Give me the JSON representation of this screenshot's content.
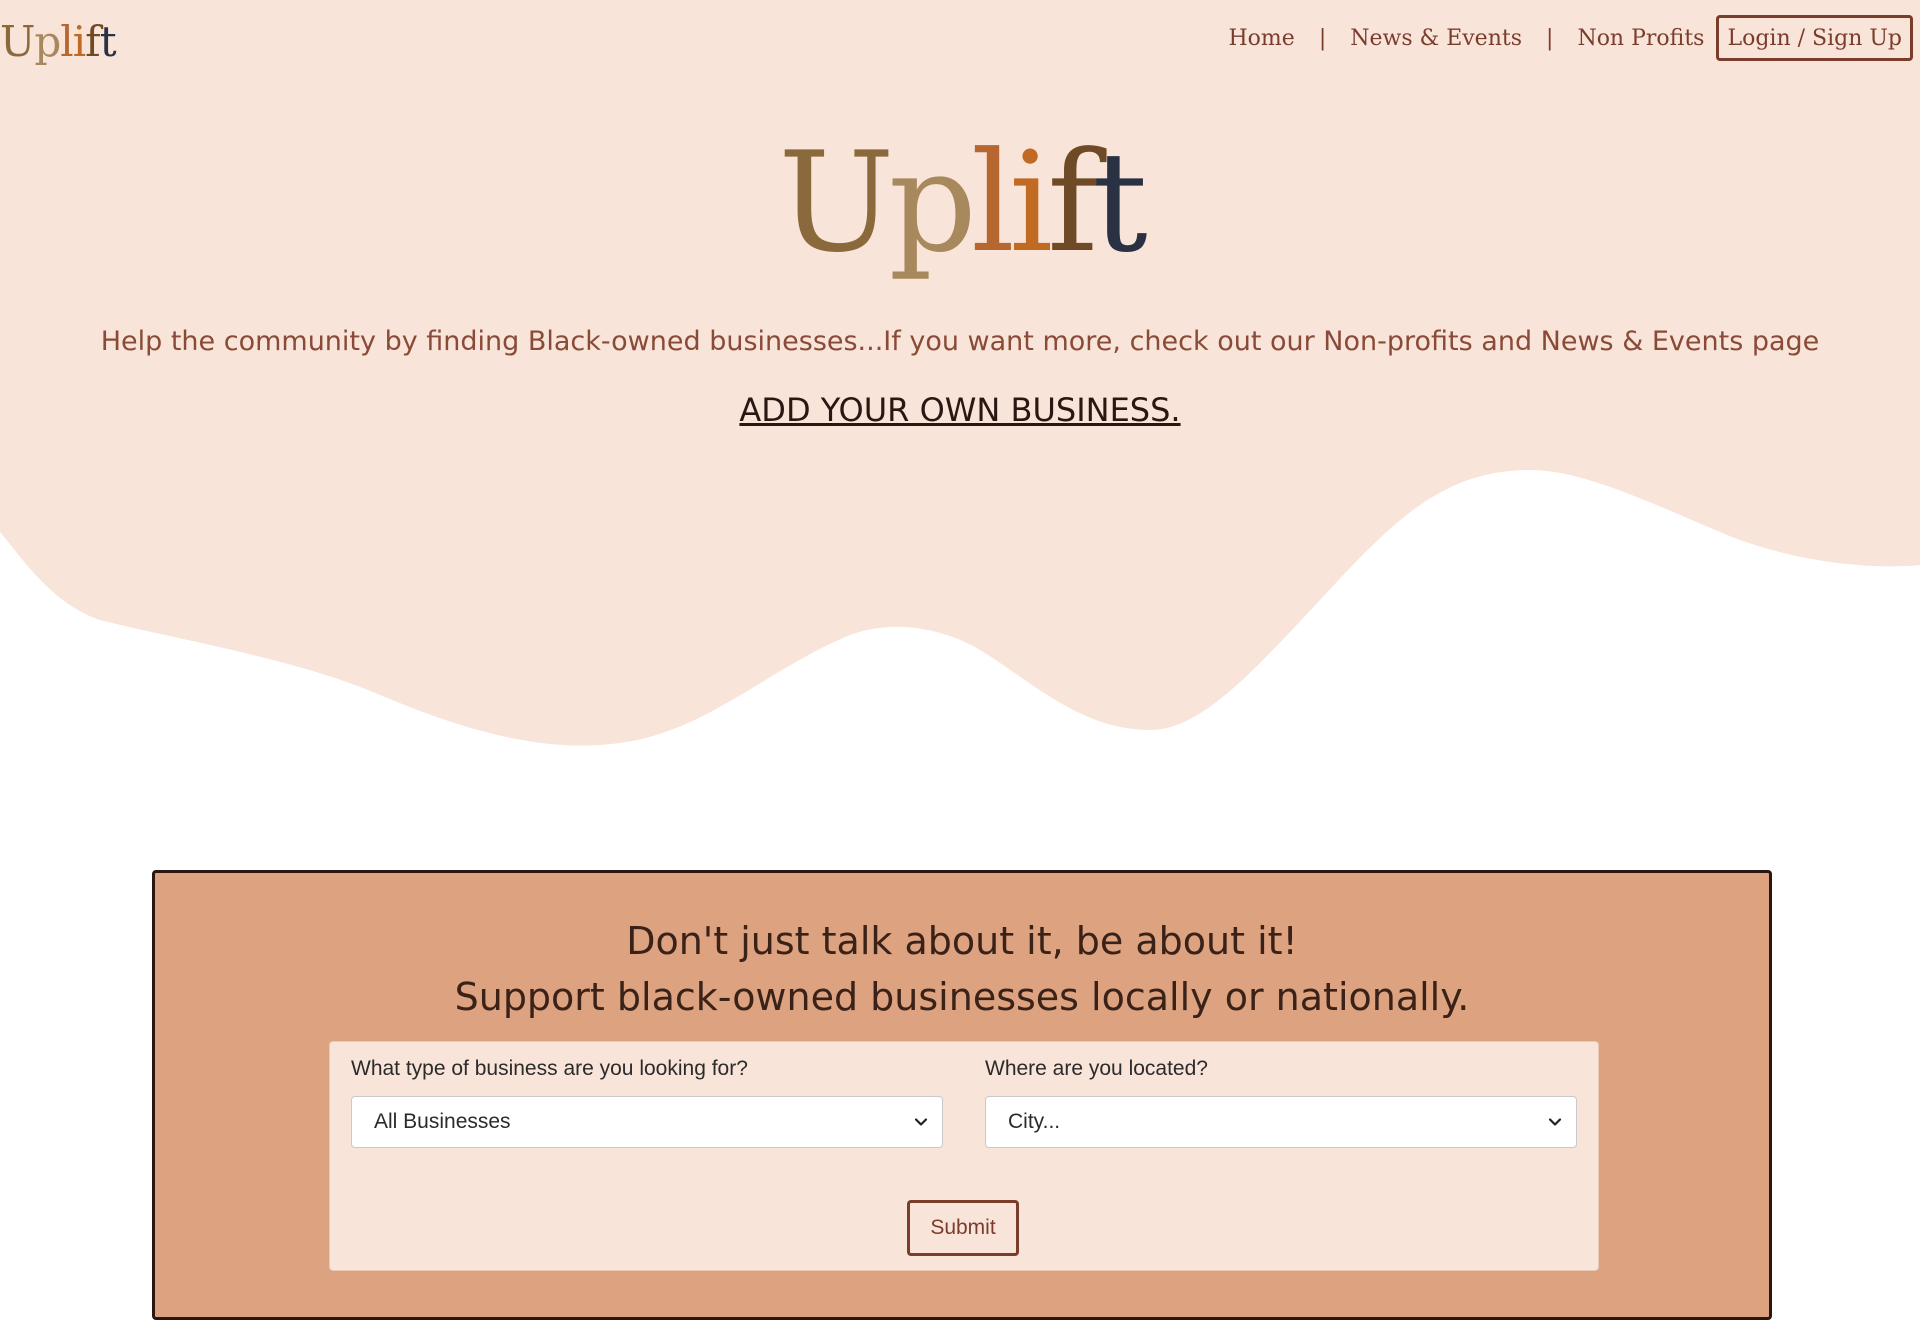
{
  "header": {
    "brand_letters": [
      "U",
      "p",
      "l",
      "i",
      "f",
      "t"
    ],
    "nav": {
      "home": "Home",
      "separator": "|",
      "news_events": "News & Events",
      "non_profits": "Non Profits",
      "login": "Login / Sign Up"
    }
  },
  "hero": {
    "title_letters": [
      "U",
      "p",
      "l",
      "i",
      "f",
      "t"
    ],
    "subtitle": "Help the community by finding Black-owned businesses...If you want more, check out our Non-profits and News & Events page",
    "add_business_link": "ADD YOUR OWN BUSINESS."
  },
  "search": {
    "headline_line1": "Don't just talk about it, be about it!",
    "headline_line2": "Support black-owned businesses locally or nationally.",
    "business_type": {
      "label": "What type of business are you looking for?",
      "selected": "All Businesses"
    },
    "location": {
      "label": "Where are you located?",
      "selected": "City..."
    },
    "submit_label": "Submit"
  },
  "icons": {
    "select_chevron": "chevron-down-icon",
    "hero_wave": "wave-shape"
  },
  "colors": {
    "hero_background": "#f9e4d9",
    "card_background": "#dda280",
    "card_border": "#2a1712",
    "accent_brown": "#7a3d2c",
    "logo_gradient": [
      "#8a6a3c",
      "#a8895e",
      "#b5672f",
      "#c06a24",
      "#6e4a26",
      "#2a3143"
    ]
  }
}
